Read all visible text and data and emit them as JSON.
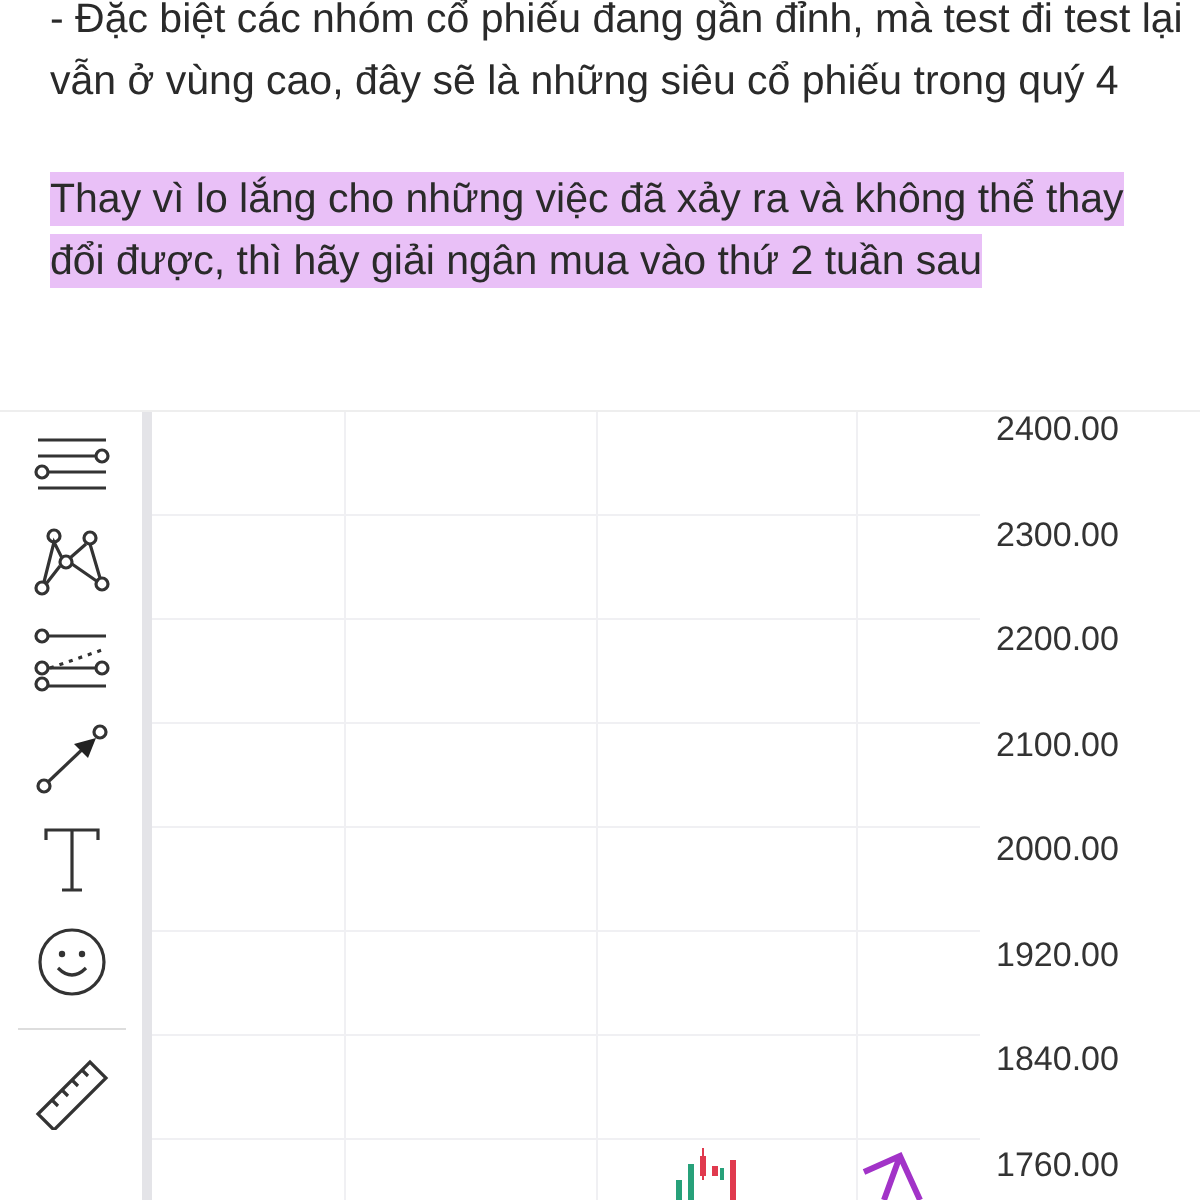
{
  "post": {
    "paragraphs": [
      {
        "text": "- Đặc biệt các nhóm cổ phiếu đang gần đỉnh, mà test đi test lại vẫn ở vùng cao, đây sẽ là những siêu cổ phiếu trong quý 4",
        "highlighted": false
      },
      {
        "text": "Thay vì lo lắng cho những việc đã xảy ra và không thể thay đổi được, thì hãy giải ngân mua vào thứ 2 tuần sau",
        "highlighted": true
      }
    ]
  },
  "chart": {
    "y_axis_labels": [
      "2400.00",
      "2300.00",
      "2200.00",
      "2100.00",
      "2000.00",
      "1920.00",
      "1840.00",
      "1760.00"
    ]
  }
}
